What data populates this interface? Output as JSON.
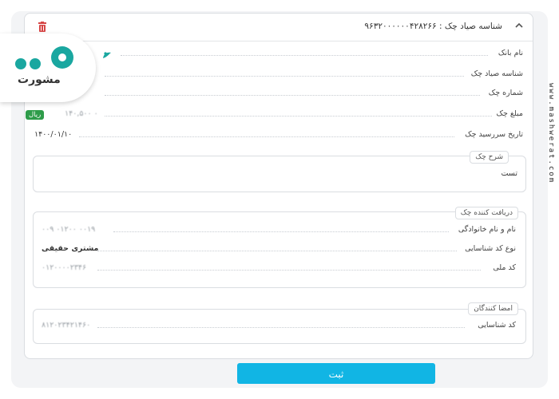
{
  "header": {
    "title": "شناسه صیاد چک : ۹۶۳۲۰۰۰۰۰۰۴۲۸۲۶۶"
  },
  "fields": {
    "bank_name": {
      "label": "نام بانک"
    },
    "sayad_id": {
      "label": "شناسه صیاد چک"
    },
    "check_number": {
      "label": "شماره چک"
    },
    "amount": {
      "label": "مبلغ چک",
      "value": "۱۴۰,۵۰۰ ۰",
      "currency": "ریال"
    },
    "due_date": {
      "label": "تاریخ سررسید چک",
      "value": "۱۴۰۰/۰۱/۱۰"
    }
  },
  "description": {
    "legend": "شرح چک",
    "value": "تست"
  },
  "receiver": {
    "legend": "دریافت کننده چک",
    "name_label": "نام و نام خانوادگی",
    "name_value": "۰۰۹ ۰۱۲۰۰ ۰۰۱۹",
    "id_type_label": "نوع کد شناسایی",
    "id_type_value": "مشتری حقیقی",
    "national_code_label": "کد ملی",
    "national_code_value": "۰۱۲۰۰۰۰۲۳۴۶"
  },
  "signers": {
    "legend": "امضا کنندگان",
    "id_label": "کد شناسایی",
    "id_value": "۸۱۲۰۲۳۴۲۱۴۶۰"
  },
  "submit": {
    "label": "ثبت"
  },
  "logo": {
    "text": "مشورت"
  },
  "watermark": "www.mashwerat.com",
  "colors": {
    "accent": "#11b5e4",
    "badge": "#2e9c4a",
    "trash": "#d64545",
    "logo_teal": "#1aa7a0"
  }
}
